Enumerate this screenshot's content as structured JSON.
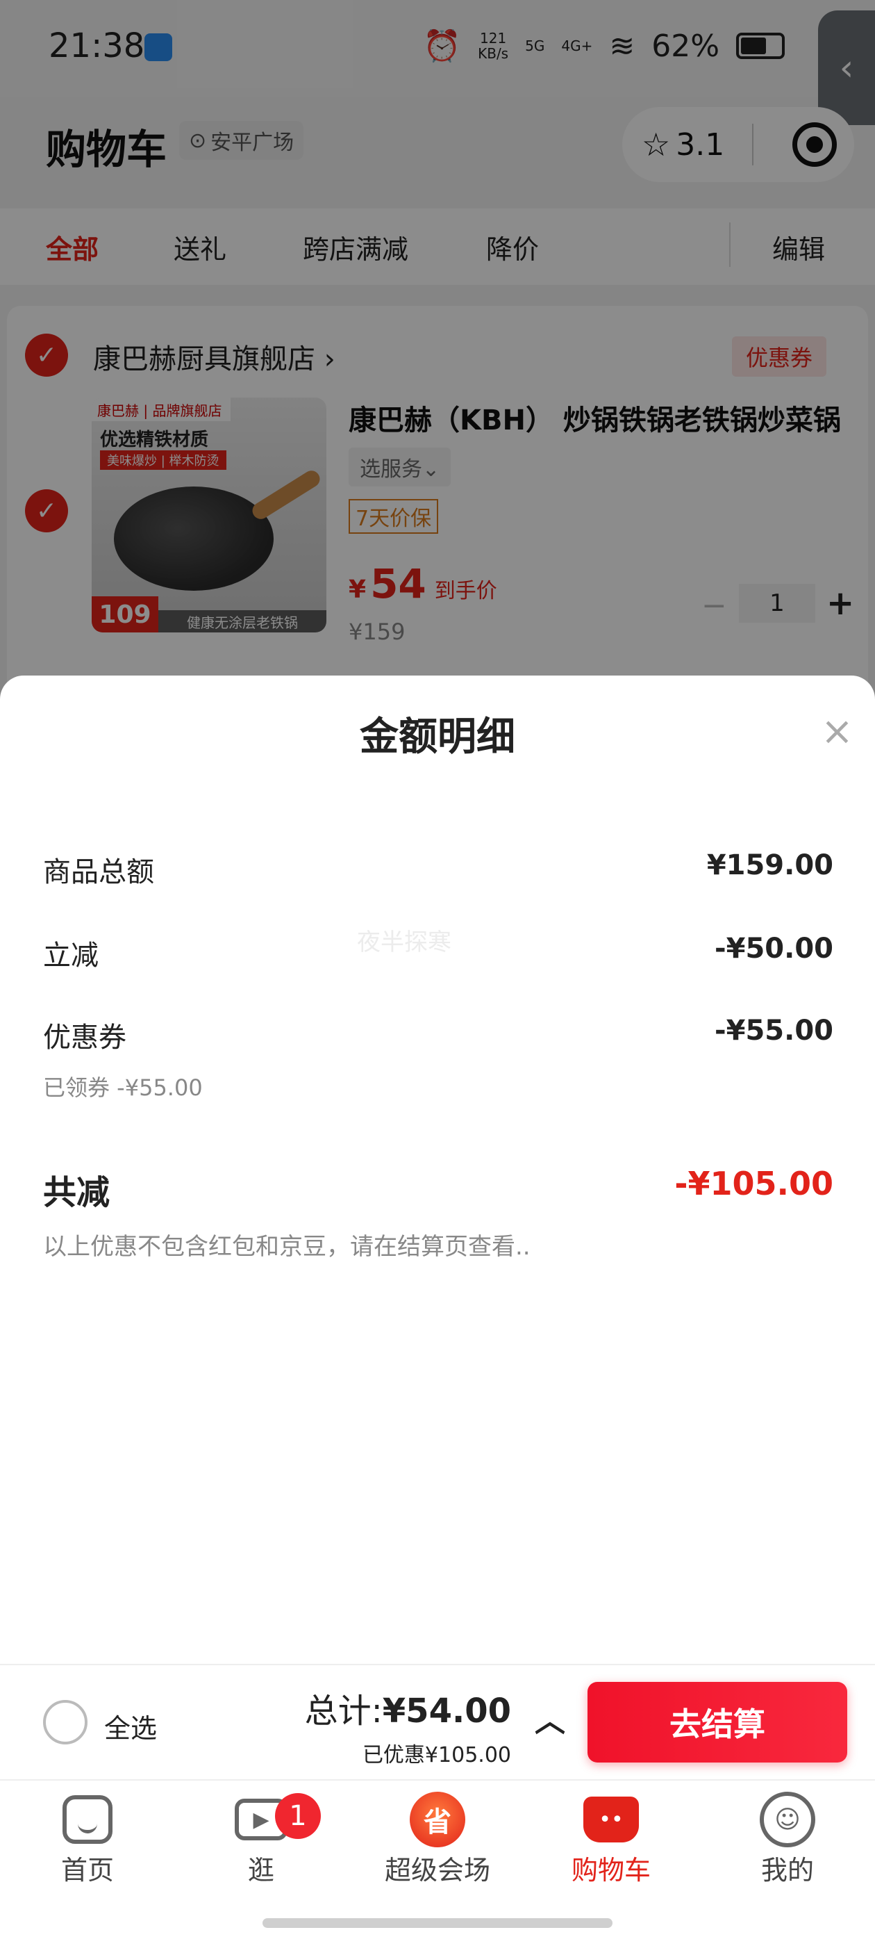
{
  "status_bar": {
    "time": "21:38",
    "net_speed": "121\nKB/s",
    "signal_1": "5G",
    "signal_2": "4G+",
    "battery_percent": "62%"
  },
  "side_tab": {
    "icon": "chevron-left-icon",
    "glyph": "‹"
  },
  "header": {
    "title": "购物车",
    "location": "安平广场",
    "location_icon": "location-pin-icon",
    "rating": "3.1",
    "star_glyph": "☆"
  },
  "filters": {
    "tabs": [
      "全部",
      "送礼",
      "跨店满减",
      "降价"
    ],
    "edit_label": "编辑"
  },
  "cart": {
    "store_name": "康巴赫厨具旗舰店",
    "store_chevron": "›",
    "coupon_tag": "优惠券",
    "product": {
      "image_brand": "康巴赫 | 品牌旗舰店",
      "image_headline": "优选精铁材质",
      "image_subline": "美味爆炒 | 榉木防烫",
      "image_price": "109",
      "image_footer": "健康无涂层老铁锅",
      "title": "康巴赫（KBH） 炒锅铁锅老铁锅炒菜锅",
      "service_select": "选服务⌄",
      "price_guard": "7天价保",
      "deal_symbol": "¥",
      "deal_price": "54",
      "deal_label": "到手价",
      "original_price": "¥159",
      "quantity": "1",
      "minus": "−",
      "plus": "+"
    }
  },
  "sheet": {
    "title": "金额明细",
    "close_glyph": "×",
    "rows": [
      {
        "label": "商品总额",
        "value": "¥159.00"
      },
      {
        "label": "立减",
        "value": "-¥50.00"
      },
      {
        "label": "优惠券",
        "value": "-¥55.00",
        "sub": "已领券 -¥55.00"
      }
    ],
    "total_label": "共减",
    "total_value": "-¥105.00",
    "note": "以上优惠不包含红包和京豆，请在结算页查看..",
    "watermark": "夜半探寒"
  },
  "checkout": {
    "select_all": "全选",
    "sum_prefix": "总计:",
    "sum_value": "¥54.00",
    "saved": "已优惠¥105.00",
    "chevron": "︿",
    "button": "去结算"
  },
  "tabbar": {
    "items": [
      {
        "label": "首页",
        "icon": "home-icon"
      },
      {
        "label": "逛",
        "icon": "video-icon",
        "badge": "1"
      },
      {
        "label": "超级会场",
        "icon": "super-venue-icon",
        "glyph": "省"
      },
      {
        "label": "购物车",
        "icon": "cart-icon",
        "glyph": "••"
      },
      {
        "label": "我的",
        "icon": "profile-icon",
        "glyph": "☺"
      }
    ]
  },
  "colors": {
    "accent": "#e2231a",
    "checkout_button": "#f0122a",
    "price_guard": "#d97a1c"
  }
}
